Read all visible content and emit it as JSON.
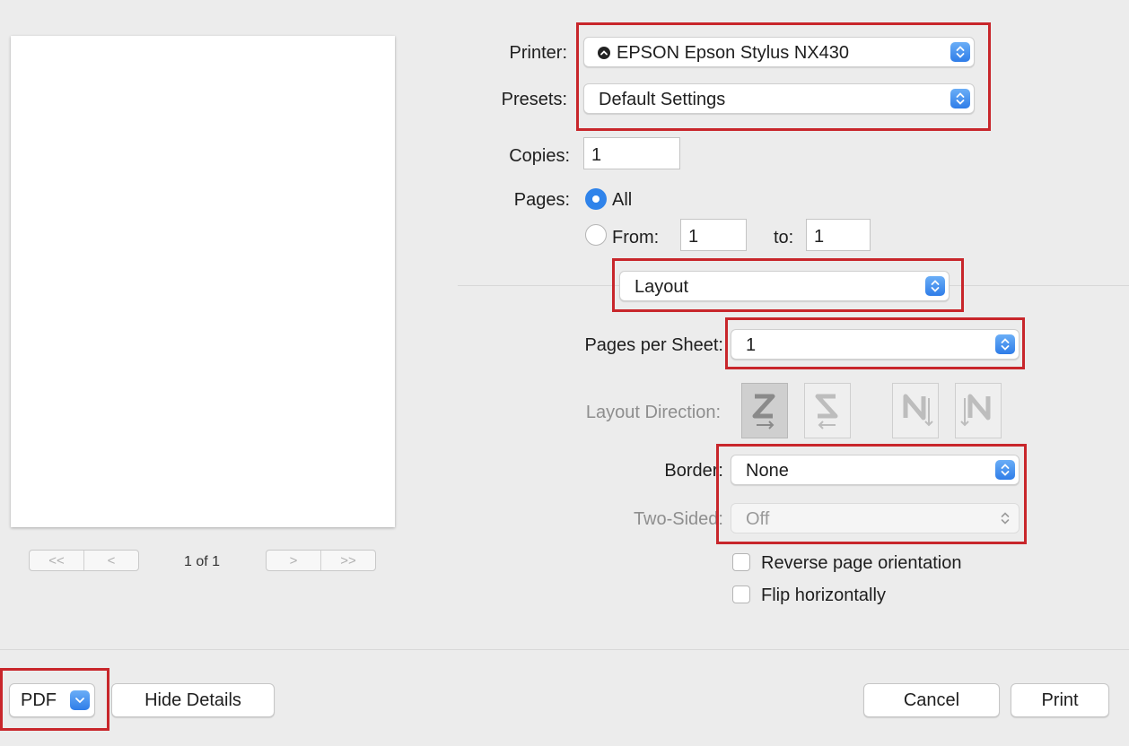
{
  "printer": {
    "label": "Printer:",
    "value": "EPSON Epson Stylus NX430",
    "icon": "printer-status-icon"
  },
  "presets": {
    "label": "Presets:",
    "value": "Default Settings"
  },
  "copies": {
    "label": "Copies:",
    "value": "1"
  },
  "pages": {
    "label": "Pages:",
    "all_label": "All",
    "from_label": "From:",
    "from_value": "1",
    "to_label": "to:",
    "to_value": "1",
    "selected": "All"
  },
  "section": {
    "value": "Layout"
  },
  "layout": {
    "pages_per_sheet_label": "Pages per Sheet:",
    "pages_per_sheet_value": "1",
    "direction_label": "Layout Direction:",
    "border_label": "Border:",
    "border_value": "None",
    "two_sided_label": "Two-Sided:",
    "two_sided_value": "Off",
    "reverse_label": "Reverse page orientation",
    "flip_label": "Flip horizontally"
  },
  "preview": {
    "first_icon": "<<",
    "prev_icon": "<",
    "next_icon": ">",
    "last_icon": ">>",
    "page_count": "1 of 1"
  },
  "footer": {
    "pdf_label": "PDF",
    "hide_details_label": "Hide Details",
    "cancel_label": "Cancel",
    "print_label": "Print"
  },
  "colors": {
    "accent": "#2f83ea",
    "highlight": "#c8262b"
  }
}
